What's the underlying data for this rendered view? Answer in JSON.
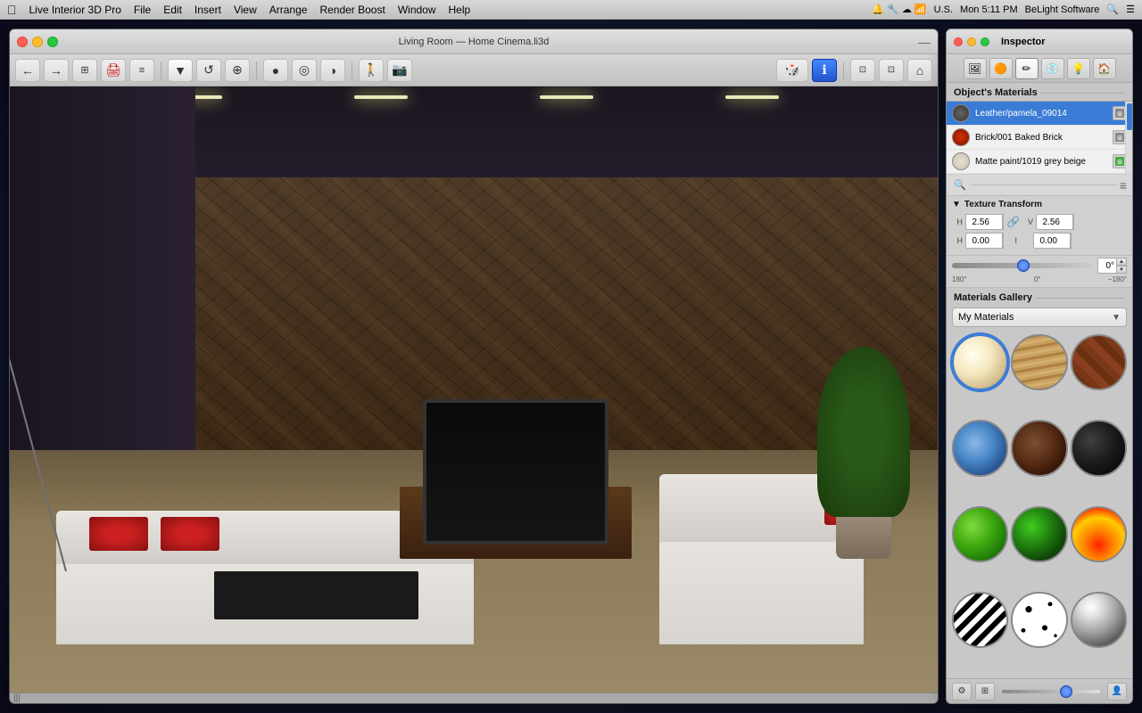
{
  "menubar": {
    "apple": "&#63743;",
    "items": [
      "Live Interior 3D Pro",
      "File",
      "Edit",
      "Insert",
      "View",
      "Arrange",
      "Render Boost",
      "Window",
      "Help"
    ],
    "right": {
      "time": "Mon 5:11 PM",
      "company": "BeLight Software",
      "locale": "U.S."
    }
  },
  "viewport_window": {
    "title": "Living Room — Home Cinema.li3d",
    "scrollbar_label": "|||"
  },
  "toolbar": {
    "nav_back": "←",
    "nav_forward": "→",
    "btn_floor": "⊞",
    "btn_render": "🖨",
    "btn_view": "≡",
    "tool_select": "▼",
    "tool_rotate": "↺",
    "tool_move": "⊕",
    "tool_circle": "●",
    "tool_target": "◎",
    "tool_arc": "◑",
    "tool_person": "🚶",
    "tool_camera": "📷",
    "view_iso": "⬜",
    "view_front": "⬜",
    "view_home": "⌂",
    "info_btn": "ℹ",
    "view_btn1": "⬜",
    "view_btn2": "⌂",
    "view_btn3": "⌂"
  },
  "inspector": {
    "title": "Inspector",
    "tabs": [
      {
        "id": "materials-tab",
        "icon": "🖼",
        "active": false
      },
      {
        "id": "texture-tab",
        "icon": "🟠",
        "active": false
      },
      {
        "id": "paint-tab",
        "icon": "✏",
        "active": true
      },
      {
        "id": "shader-tab",
        "icon": "💿",
        "active": false
      },
      {
        "id": "light-tab",
        "icon": "💡",
        "active": false
      },
      {
        "id": "home-tab",
        "icon": "🏠",
        "active": false
      }
    ],
    "objects_materials_label": "Object's Materials",
    "materials": [
      {
        "id": "mat1",
        "name": "Leather/pamela_09014",
        "selected": true
      },
      {
        "id": "mat2",
        "name": "Brick/001 Baked Brick",
        "selected": false
      },
      {
        "id": "mat3",
        "name": "Matte paint/1019 grey beige",
        "selected": false
      }
    ],
    "texture_transform": {
      "label": "Texture Transform",
      "scale_x": "2.56",
      "scale_y": "2.56",
      "offset_x": "0.00",
      "offset_y": "0.00",
      "angle": "0°",
      "angle_min": "180°",
      "angle_mid": "0°",
      "angle_max": "−180°"
    },
    "gallery": {
      "label": "Materials Gallery",
      "dropdown_value": "My Materials",
      "swatches": [
        {
          "id": "swatch-cream",
          "class": "swatch-cream",
          "selected": true
        },
        {
          "id": "swatch-wood-light",
          "class": "swatch-wood-light",
          "selected": false
        },
        {
          "id": "swatch-brick",
          "class": "swatch-brick",
          "selected": false
        },
        {
          "id": "swatch-water",
          "class": "swatch-water",
          "selected": false
        },
        {
          "id": "swatch-wood-dark",
          "class": "swatch-wood-dark",
          "selected": false
        },
        {
          "id": "swatch-black",
          "class": "swatch-black",
          "selected": false
        },
        {
          "id": "swatch-green-bright",
          "class": "swatch-green-bright",
          "selected": false
        },
        {
          "id": "swatch-green-dark",
          "class": "swatch-green-dark",
          "selected": false
        },
        {
          "id": "swatch-fire",
          "class": "swatch-fire",
          "selected": false
        },
        {
          "id": "swatch-zebra",
          "class": "swatch-zebra",
          "selected": false
        },
        {
          "id": "swatch-spots",
          "class": "swatch-spots",
          "selected": false
        },
        {
          "id": "swatch-chrome",
          "class": "swatch-chrome",
          "selected": false
        }
      ]
    }
  }
}
